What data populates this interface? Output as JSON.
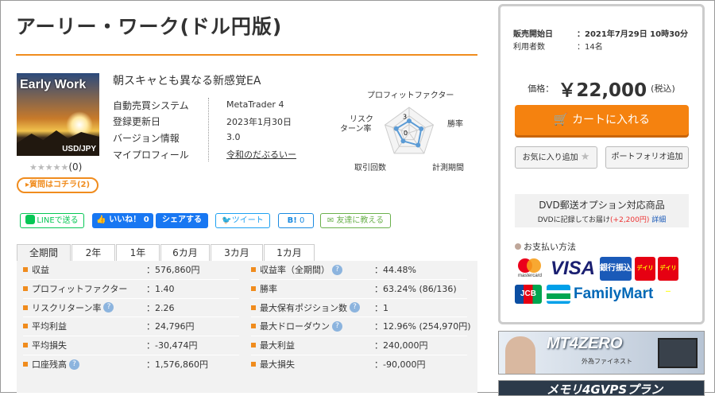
{
  "page_title": "アーリー・ワーク(ドル円版)",
  "product": {
    "thumb_title": "Early Work",
    "thumb_pair": "USD/JPY",
    "stars": "★★★★★",
    "review_count": "(0)",
    "question_button": "▸質問はコチラ(2)",
    "subtitle": "朝スキャとも異なる新感覚EA",
    "info": [
      {
        "label": "自動売買システム",
        "value": "MetaTrader 4"
      },
      {
        "label": "登録更新日",
        "value": "2023年1月30日"
      },
      {
        "label": "バージョン情報",
        "value": "3.0"
      },
      {
        "label": "マイプロフィール",
        "value": "令和のだぶるいー"
      }
    ]
  },
  "radar": {
    "labels": {
      "top": "プロフィットファクター",
      "right": "勝率",
      "bottom_right": "計測期間",
      "bottom_left": "取引回数",
      "left_1": "リスク",
      "left_2": "ターン率"
    },
    "scale_max": "3",
    "scale_min": "0",
    "values": [
      1.4,
      1.5,
      1.8,
      1.2,
      1.6
    ],
    "max": 3,
    "line_color": "#5b9bd5"
  },
  "social": {
    "line": "LINEで送る",
    "like": "いいね！",
    "like_count": "0",
    "share": "シェアする",
    "tweet": "ツイート",
    "hatena": "B!",
    "hatena_count": "0",
    "tell_friend": "友達に教える"
  },
  "tabs": [
    "全期間",
    "2年",
    "1年",
    "6カ月",
    "3カ月",
    "1カ月"
  ],
  "stats_left": [
    {
      "label": "収益",
      "value": "：576,860円",
      "help": false
    },
    {
      "label": "プロフィットファクター",
      "value": "：1.40",
      "help": false
    },
    {
      "label": "リスクリターン率",
      "value": "：2.26",
      "help": true
    },
    {
      "label": "平均利益",
      "value": "：24,796円",
      "help": false
    },
    {
      "label": "平均損失",
      "value": "：-30,474円",
      "help": false
    },
    {
      "label": "口座残高",
      "value": "：1,576,860円",
      "help": true
    }
  ],
  "stats_right": [
    {
      "label": "収益率（全期間）",
      "value": "：44.48%",
      "help": true
    },
    {
      "label": "勝率",
      "value": "：63.24% (86/136)",
      "help": false
    },
    {
      "label": "最大保有ポジション数",
      "value": "：1",
      "help": true
    },
    {
      "label": "最大ドローダウン",
      "value": "：12.96% (254,970円)",
      "help": true
    },
    {
      "label": "最大利益",
      "value": "：240,000円",
      "help": false
    },
    {
      "label": "最大損失",
      "value": "：-90,000円",
      "help": false
    }
  ],
  "sidebar": {
    "sale_start_label": "販売開始日",
    "sale_start_value": "：2021年7月29日 10時30分",
    "users_label": "利用者数",
    "users_value": "：14名",
    "price_label": "価格：",
    "price_value": "￥22,000",
    "price_tax": "(税込)",
    "cart": "カートに入れる",
    "favorite": "お気に入り追加",
    "portfolio": "ポートフォリオ追加",
    "dvd_title": "DVD郵送オプション対応商品",
    "dvd_sub1": "DVDに記録してお届け",
    "dvd_sub2": "(+2,200円)",
    "dvd_link": "詳細",
    "payment_title": "お支払い方法",
    "pay_labels": {
      "mastercard": "mastercard",
      "visa": "VISA",
      "bank": "銀行振込",
      "daily1": "デイリー",
      "daily2": "デイリー",
      "jcb": "JCB",
      "familymart": "FamilyMart"
    }
  },
  "banners": {
    "mt4zero": "MT4ZERO",
    "mt4zero_sub": "外為ファイネスト",
    "vps": "メモリ4GVPSプラン"
  },
  "colors": {
    "accent": "#f08c1e",
    "cart": "#f5820f",
    "link": "#1a5ab8",
    "twitter": "#1da1f2",
    "line": "#06c755",
    "facebook": "#1877f2"
  }
}
